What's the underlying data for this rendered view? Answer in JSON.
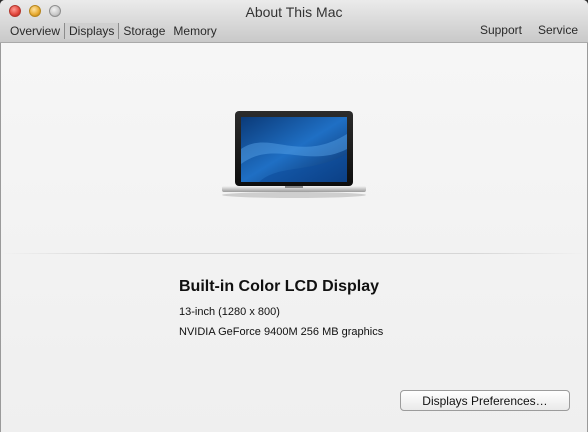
{
  "window": {
    "title": "About This Mac"
  },
  "toolbar": {
    "tabs_left": [
      "Overview",
      "Displays",
      "Storage",
      "Memory"
    ],
    "active_tab": "Displays",
    "tabs_right": [
      "Support",
      "Service"
    ]
  },
  "display": {
    "name": "Built-in Color LCD Display",
    "size": "13-inch (1280 x 800)",
    "graphics": "NVIDIA GeForce 9400M 256 MB graphics"
  },
  "buttons": {
    "prefs_label": "Displays Preferences…"
  },
  "icons": {
    "close": "close-icon",
    "minimize": "minimize-icon",
    "zoom": "zoom-icon",
    "laptop": "laptop-icon"
  },
  "colors": {
    "window_bg": "#ececec",
    "titlebar": "#d8d8d8",
    "text": "#111111"
  }
}
